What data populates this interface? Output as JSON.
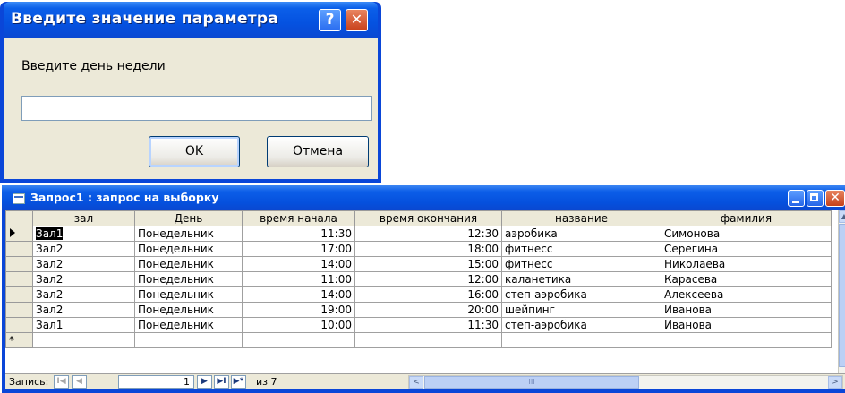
{
  "dialog": {
    "title": "Введите значение параметра",
    "help_glyph": "?",
    "close_glyph": "✕",
    "prompt": "Введите день недели",
    "input_value": "",
    "ok_label": "OK",
    "cancel_label": "Отмена"
  },
  "query_window": {
    "title": "Запрос1 : запрос на выборку",
    "columns": [
      "зал",
      "День",
      "время начала",
      "время окончания",
      "название",
      "фамилия"
    ],
    "rows": [
      [
        "Зал1",
        "Понедельник",
        "11:30",
        "12:30",
        "аэробика",
        "Симонова"
      ],
      [
        "Зал2",
        "Понедельник",
        "17:00",
        "18:00",
        "фитнесс",
        "Серегина"
      ],
      [
        "Зал2",
        "Понедельник",
        "14:00",
        "15:00",
        "фитнесс",
        "Николаева"
      ],
      [
        "Зал2",
        "Понедельник",
        "11:00",
        "12:00",
        "каланетика",
        "Карасева"
      ],
      [
        "Зал2",
        "Понедельник",
        "14:00",
        "16:00",
        "степ-аэробика",
        "Алексеева"
      ],
      [
        "Зал2",
        "Понедельник",
        "19:00",
        "20:00",
        "шейпинг",
        "Иванова"
      ],
      [
        "Зал1",
        "Понедельник",
        "10:00",
        "11:30",
        "степ-аэробика",
        "Иванова"
      ]
    ],
    "new_row_marker": "*",
    "navigator": {
      "label": "Запись:",
      "current_record": "1",
      "of_label": "из 7",
      "first_glyph": "I◀",
      "prev_glyph": "◀",
      "next_glyph": "▶",
      "last_glyph": "▶I",
      "new_glyph": "▶*"
    },
    "scroll": {
      "left_glyph": "<",
      "right_glyph": ">",
      "up_glyph": "▲",
      "thumb_grip": "III"
    }
  }
}
